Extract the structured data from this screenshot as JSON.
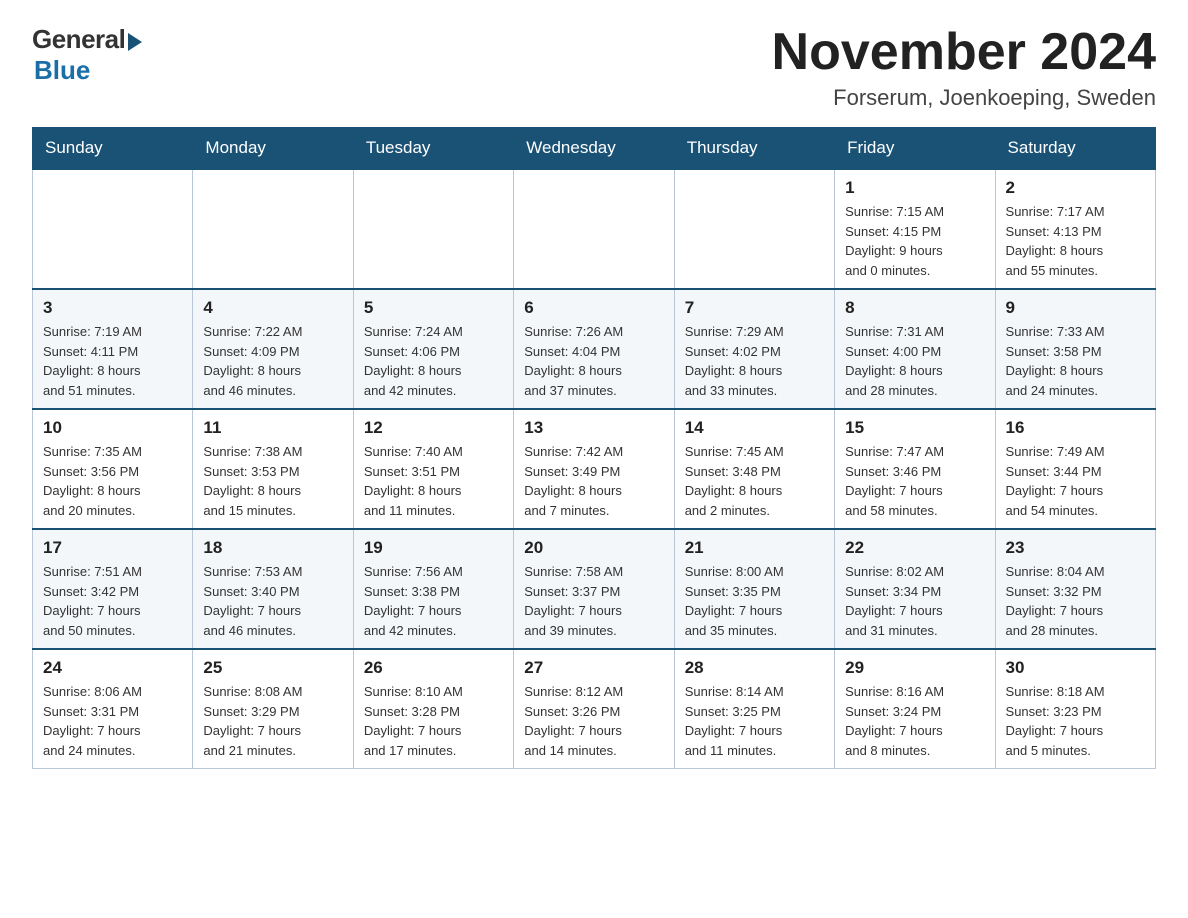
{
  "logo": {
    "general": "General",
    "blue": "Blue"
  },
  "title": "November 2024",
  "location": "Forserum, Joenkoeping, Sweden",
  "days_of_week": [
    "Sunday",
    "Monday",
    "Tuesday",
    "Wednesday",
    "Thursday",
    "Friday",
    "Saturday"
  ],
  "weeks": [
    [
      {
        "day": "",
        "info": ""
      },
      {
        "day": "",
        "info": ""
      },
      {
        "day": "",
        "info": ""
      },
      {
        "day": "",
        "info": ""
      },
      {
        "day": "",
        "info": ""
      },
      {
        "day": "1",
        "info": "Sunrise: 7:15 AM\nSunset: 4:15 PM\nDaylight: 9 hours\nand 0 minutes."
      },
      {
        "day": "2",
        "info": "Sunrise: 7:17 AM\nSunset: 4:13 PM\nDaylight: 8 hours\nand 55 minutes."
      }
    ],
    [
      {
        "day": "3",
        "info": "Sunrise: 7:19 AM\nSunset: 4:11 PM\nDaylight: 8 hours\nand 51 minutes."
      },
      {
        "day": "4",
        "info": "Sunrise: 7:22 AM\nSunset: 4:09 PM\nDaylight: 8 hours\nand 46 minutes."
      },
      {
        "day": "5",
        "info": "Sunrise: 7:24 AM\nSunset: 4:06 PM\nDaylight: 8 hours\nand 42 minutes."
      },
      {
        "day": "6",
        "info": "Sunrise: 7:26 AM\nSunset: 4:04 PM\nDaylight: 8 hours\nand 37 minutes."
      },
      {
        "day": "7",
        "info": "Sunrise: 7:29 AM\nSunset: 4:02 PM\nDaylight: 8 hours\nand 33 minutes."
      },
      {
        "day": "8",
        "info": "Sunrise: 7:31 AM\nSunset: 4:00 PM\nDaylight: 8 hours\nand 28 minutes."
      },
      {
        "day": "9",
        "info": "Sunrise: 7:33 AM\nSunset: 3:58 PM\nDaylight: 8 hours\nand 24 minutes."
      }
    ],
    [
      {
        "day": "10",
        "info": "Sunrise: 7:35 AM\nSunset: 3:56 PM\nDaylight: 8 hours\nand 20 minutes."
      },
      {
        "day": "11",
        "info": "Sunrise: 7:38 AM\nSunset: 3:53 PM\nDaylight: 8 hours\nand 15 minutes."
      },
      {
        "day": "12",
        "info": "Sunrise: 7:40 AM\nSunset: 3:51 PM\nDaylight: 8 hours\nand 11 minutes."
      },
      {
        "day": "13",
        "info": "Sunrise: 7:42 AM\nSunset: 3:49 PM\nDaylight: 8 hours\nand 7 minutes."
      },
      {
        "day": "14",
        "info": "Sunrise: 7:45 AM\nSunset: 3:48 PM\nDaylight: 8 hours\nand 2 minutes."
      },
      {
        "day": "15",
        "info": "Sunrise: 7:47 AM\nSunset: 3:46 PM\nDaylight: 7 hours\nand 58 minutes."
      },
      {
        "day": "16",
        "info": "Sunrise: 7:49 AM\nSunset: 3:44 PM\nDaylight: 7 hours\nand 54 minutes."
      }
    ],
    [
      {
        "day": "17",
        "info": "Sunrise: 7:51 AM\nSunset: 3:42 PM\nDaylight: 7 hours\nand 50 minutes."
      },
      {
        "day": "18",
        "info": "Sunrise: 7:53 AM\nSunset: 3:40 PM\nDaylight: 7 hours\nand 46 minutes."
      },
      {
        "day": "19",
        "info": "Sunrise: 7:56 AM\nSunset: 3:38 PM\nDaylight: 7 hours\nand 42 minutes."
      },
      {
        "day": "20",
        "info": "Sunrise: 7:58 AM\nSunset: 3:37 PM\nDaylight: 7 hours\nand 39 minutes."
      },
      {
        "day": "21",
        "info": "Sunrise: 8:00 AM\nSunset: 3:35 PM\nDaylight: 7 hours\nand 35 minutes."
      },
      {
        "day": "22",
        "info": "Sunrise: 8:02 AM\nSunset: 3:34 PM\nDaylight: 7 hours\nand 31 minutes."
      },
      {
        "day": "23",
        "info": "Sunrise: 8:04 AM\nSunset: 3:32 PM\nDaylight: 7 hours\nand 28 minutes."
      }
    ],
    [
      {
        "day": "24",
        "info": "Sunrise: 8:06 AM\nSunset: 3:31 PM\nDaylight: 7 hours\nand 24 minutes."
      },
      {
        "day": "25",
        "info": "Sunrise: 8:08 AM\nSunset: 3:29 PM\nDaylight: 7 hours\nand 21 minutes."
      },
      {
        "day": "26",
        "info": "Sunrise: 8:10 AM\nSunset: 3:28 PM\nDaylight: 7 hours\nand 17 minutes."
      },
      {
        "day": "27",
        "info": "Sunrise: 8:12 AM\nSunset: 3:26 PM\nDaylight: 7 hours\nand 14 minutes."
      },
      {
        "day": "28",
        "info": "Sunrise: 8:14 AM\nSunset: 3:25 PM\nDaylight: 7 hours\nand 11 minutes."
      },
      {
        "day": "29",
        "info": "Sunrise: 8:16 AM\nSunset: 3:24 PM\nDaylight: 7 hours\nand 8 minutes."
      },
      {
        "day": "30",
        "info": "Sunrise: 8:18 AM\nSunset: 3:23 PM\nDaylight: 7 hours\nand 5 minutes."
      }
    ]
  ]
}
